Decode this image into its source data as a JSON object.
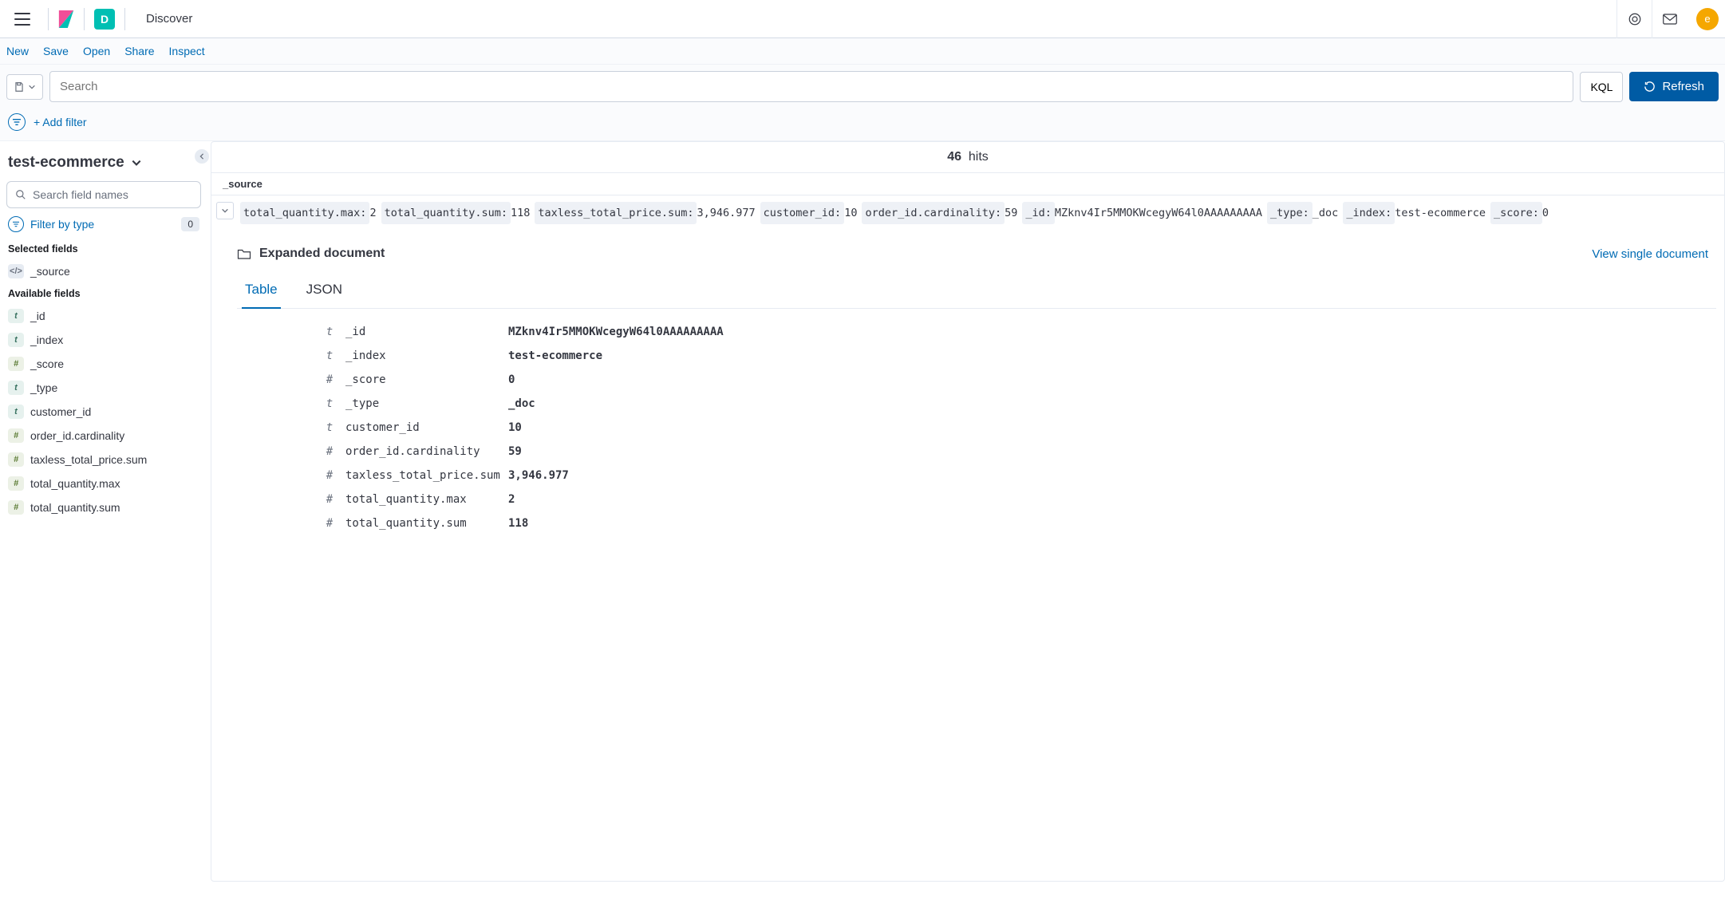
{
  "header": {
    "app_initial": "D",
    "title": "Discover",
    "avatar_initial": "e"
  },
  "subnav": {
    "new": "New",
    "save": "Save",
    "open": "Open",
    "share": "Share",
    "inspect": "Inspect"
  },
  "querybar": {
    "search_placeholder": "Search",
    "kql_label": "KQL",
    "refresh_label": "Refresh"
  },
  "filterbar": {
    "add_filter": "+ Add filter"
  },
  "sidebar": {
    "index_pattern": "test-ecommerce",
    "field_search_placeholder": "Search field names",
    "filter_by_type": "Filter by type",
    "filter_by_type_count": "0",
    "selected_label": "Selected fields",
    "available_label": "Available fields",
    "selected_fields": [
      {
        "type": "src",
        "name": "_source"
      }
    ],
    "available_fields": [
      {
        "type": "t",
        "name": "_id"
      },
      {
        "type": "t",
        "name": "_index"
      },
      {
        "type": "#",
        "name": "_score"
      },
      {
        "type": "t",
        "name": "_type"
      },
      {
        "type": "t",
        "name": "customer_id"
      },
      {
        "type": "#",
        "name": "order_id.cardinality"
      },
      {
        "type": "#",
        "name": "taxless_total_price.sum"
      },
      {
        "type": "#",
        "name": "total_quantity.max"
      },
      {
        "type": "#",
        "name": "total_quantity.sum"
      }
    ]
  },
  "results": {
    "hits_count": "46",
    "hits_label": "hits",
    "source_header": "_source",
    "source_pairs": [
      {
        "k": "total_quantity.max:",
        "v": "2"
      },
      {
        "k": "total_quantity.sum:",
        "v": "118"
      },
      {
        "k": "taxless_total_price.sum:",
        "v": "3,946.977"
      },
      {
        "k": "customer_id:",
        "v": "10"
      },
      {
        "k": "order_id.cardinality:",
        "v": "59"
      },
      {
        "k": "_id:",
        "v": "MZknv4Ir5MMOKWcegyW64l0AAAAAAAAA"
      },
      {
        "k": "_type:",
        "v": "_doc"
      },
      {
        "k": "_index:",
        "v": "test-ecommerce"
      },
      {
        "k": "_score:",
        "v": "0"
      }
    ],
    "expanded_label": "Expanded document",
    "view_single": "View single document",
    "tabs": {
      "table": "Table",
      "json": "JSON"
    },
    "doc_table": [
      {
        "t": "t",
        "k": "_id",
        "v": "MZknv4Ir5MMOKWcegyW64l0AAAAAAAAA"
      },
      {
        "t": "t",
        "k": "_index",
        "v": "test-ecommerce"
      },
      {
        "t": "#",
        "k": "_score",
        "v": "0"
      },
      {
        "t": "t",
        "k": "_type",
        "v": "_doc"
      },
      {
        "t": "t",
        "k": "customer_id",
        "v": "10"
      },
      {
        "t": "#",
        "k": "order_id.cardinality",
        "v": "59"
      },
      {
        "t": "#",
        "k": "taxless_total_price.sum",
        "v": "3,946.977"
      },
      {
        "t": "#",
        "k": "total_quantity.max",
        "v": "2"
      },
      {
        "t": "#",
        "k": "total_quantity.sum",
        "v": "118"
      }
    ]
  }
}
